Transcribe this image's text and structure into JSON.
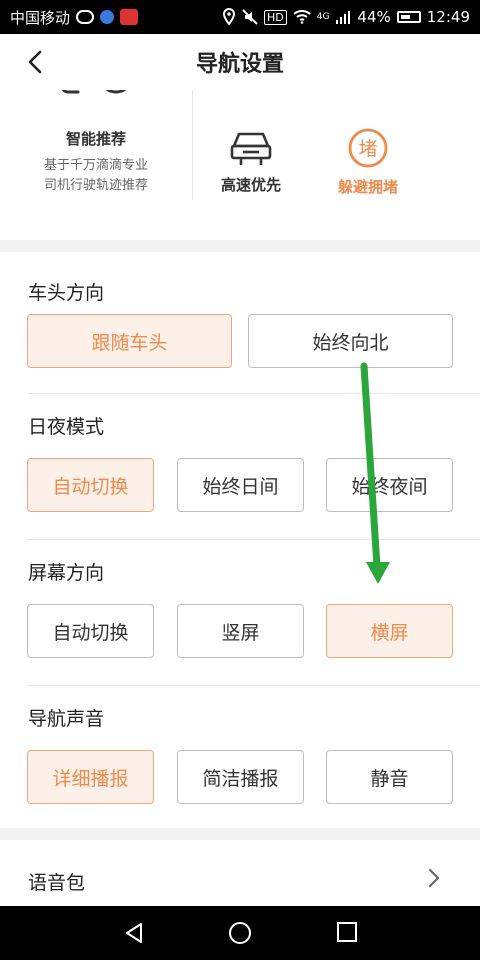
{
  "status_bar": {
    "carrier": "中国移动",
    "network": "4G",
    "battery": "44%",
    "time": "12:49"
  },
  "header": {
    "title": "导航设置"
  },
  "route_prefs": {
    "smart": {
      "title": "智能推荐",
      "desc_line1": "基于千万滴滴专业",
      "desc_line2": "司机行驶轨迹推荐"
    },
    "highway": {
      "label": "高速优先"
    },
    "avoid_jam": {
      "label": "躲避拥堵",
      "icon_char": "堵"
    }
  },
  "settings": {
    "heading": {
      "title": "车头方向",
      "options": [
        "跟随车头",
        "始终向北"
      ],
      "selected": 0
    },
    "day_night": {
      "title": "日夜模式",
      "options": [
        "自动切换",
        "始终日间",
        "始终夜间"
      ],
      "selected": 0
    },
    "screen": {
      "title": "屏幕方向",
      "options": [
        "自动切换",
        "竖屏",
        "横屏"
      ],
      "selected": 2
    },
    "voice": {
      "title": "导航声音",
      "options": [
        "详细播报",
        "简洁播报",
        "静音"
      ],
      "selected": 0
    }
  },
  "voice_pack": {
    "label": "语音包"
  },
  "colors": {
    "accent": "#f08a4b",
    "selected_bg": "#fdf0e8",
    "annotation_arrow": "#2aa63a"
  }
}
